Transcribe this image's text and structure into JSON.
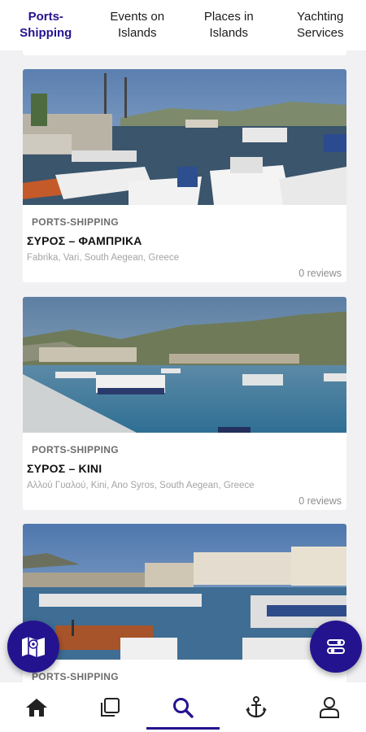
{
  "tabs": [
    {
      "label": "Ports-Shipping",
      "active": true
    },
    {
      "label": "Events on Islands",
      "active": false
    },
    {
      "label": "Places in Islands",
      "active": false
    },
    {
      "label": "Yachting Services",
      "active": false
    }
  ],
  "cards": [
    {
      "category": "PORTS-SHIPPING",
      "title": "ΣΥΡΟΣ – ΦΑΜΠΡΙΚΑ",
      "address": "Fabrika, Vari, South Aegean, Greece",
      "reviews": "0 reviews"
    },
    {
      "category": "PORTS-SHIPPING",
      "title": "ΣΥΡΟΣ – ΚΙΝΙ",
      "address": "Αλλού Γυαλού, Kini, Ano Syros, South Aegean, Greece",
      "reviews": "0 reviews"
    },
    {
      "category": "PORTS-SHIPPING"
    }
  ],
  "fabs": {
    "left_icon": "map-icon",
    "right_icon": "filter-toggle-icon"
  },
  "bottom_nav": [
    {
      "icon": "home-icon",
      "active": false
    },
    {
      "icon": "listings-icon",
      "active": false
    },
    {
      "icon": "search-icon",
      "active": true
    },
    {
      "icon": "anchor-icon",
      "active": false
    },
    {
      "icon": "profile-icon",
      "active": false
    }
  ],
  "colors": {
    "accent": "#24138f",
    "background": "#f1f1f3"
  }
}
